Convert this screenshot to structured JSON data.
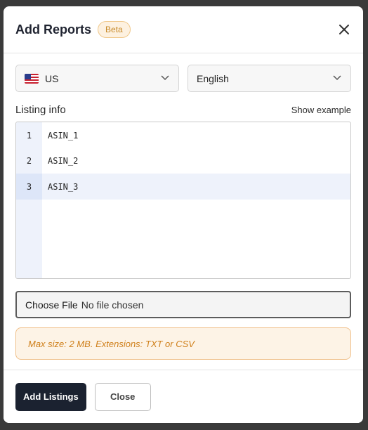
{
  "modal": {
    "title": "Add Reports",
    "badge": "Beta",
    "close_icon": "close-icon"
  },
  "country_select": {
    "flag_icon": "us-flag-icon",
    "value": "US"
  },
  "language_select": {
    "value": "English"
  },
  "listing": {
    "label": "Listing info",
    "show_example": "Show example",
    "lines": [
      {
        "number": "1",
        "text": "ASIN_1"
      },
      {
        "number": "2",
        "text": "ASIN_2"
      },
      {
        "number": "3",
        "text": "ASIN_3"
      }
    ]
  },
  "file_input": {
    "button_label": "Choose File",
    "status": "No file chosen"
  },
  "notice": {
    "text": "Max size: 2 MB. Extensions: TXT or CSV"
  },
  "footer": {
    "primary_label": "Add Listings",
    "secondary_label": "Close"
  },
  "colors": {
    "primary": "#1b2230",
    "beta_text": "#c88a2a",
    "notice_text": "#cf7f1a",
    "gutter": "#eef2fb"
  }
}
